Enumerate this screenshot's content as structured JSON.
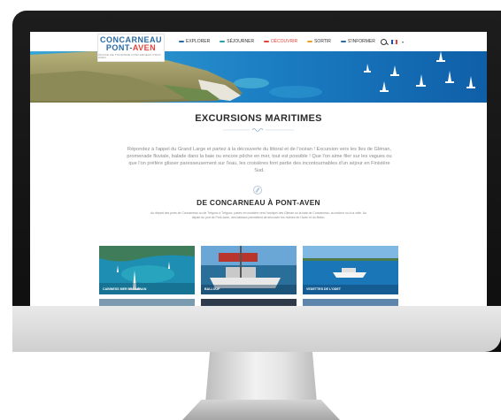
{
  "brand": {
    "logo_line1": "CONCARNEAU",
    "logo_line2_a": "PONT-",
    "logo_line2_b": "AVEN",
    "logo_tagline": "OFFICE DE TOURISME CONCARNEAU PONT-AVEN"
  },
  "nav": {
    "items": [
      {
        "label": "EXPLORER",
        "color": "#2a6aa3"
      },
      {
        "label": "SÉJOURNER",
        "color": "#2aa1a8"
      },
      {
        "label": "DÉCOUVRIR",
        "color": "#e2443a"
      },
      {
        "label": "SORTIR",
        "color": "#f0a020"
      },
      {
        "label": "S'INFORMER",
        "color": "#2a6aa3"
      }
    ],
    "active_index": 2,
    "language_chevron": "▾"
  },
  "page": {
    "title": "EXCURSIONS MARITIMES",
    "intro": "Répondez à l'appel du Grand Large et partez à la découverte du littoral et de l'océan ! Excursion vers les îles de Glénan, promenade fluviale, balade dans la baie ou encore pêche en mer, tout est possible ! Que l'on aime filer sur les vagues ou que l'on préfère glisser paresseusement sur l'eau, les croisières font partie des incontournables d'un séjour en Finistère Sud."
  },
  "section": {
    "title": "DE CONCARNEAU À PONT-AVEN",
    "text": "Au départ des ports de Concarneau ou de Trégunc à Trégunc, partez en croisière vers l'archipel des Glénan ou la baie de Concarneau, au moteur ou à la voile. Au départ du port de Pont-Aven, des bateaux permettent de découvrir les rivières de l'Aven et du Belon."
  },
  "cards": [
    {
      "label": "CABINESS MER ET GLÉNAN"
    },
    {
      "label": "BALLOUP"
    },
    {
      "label": "VEDETTES DE L'ODET"
    }
  ],
  "colors": {
    "accent": "#e2443a",
    "brand_blue": "#2a6aa3",
    "sea": "#1f8fd0"
  }
}
